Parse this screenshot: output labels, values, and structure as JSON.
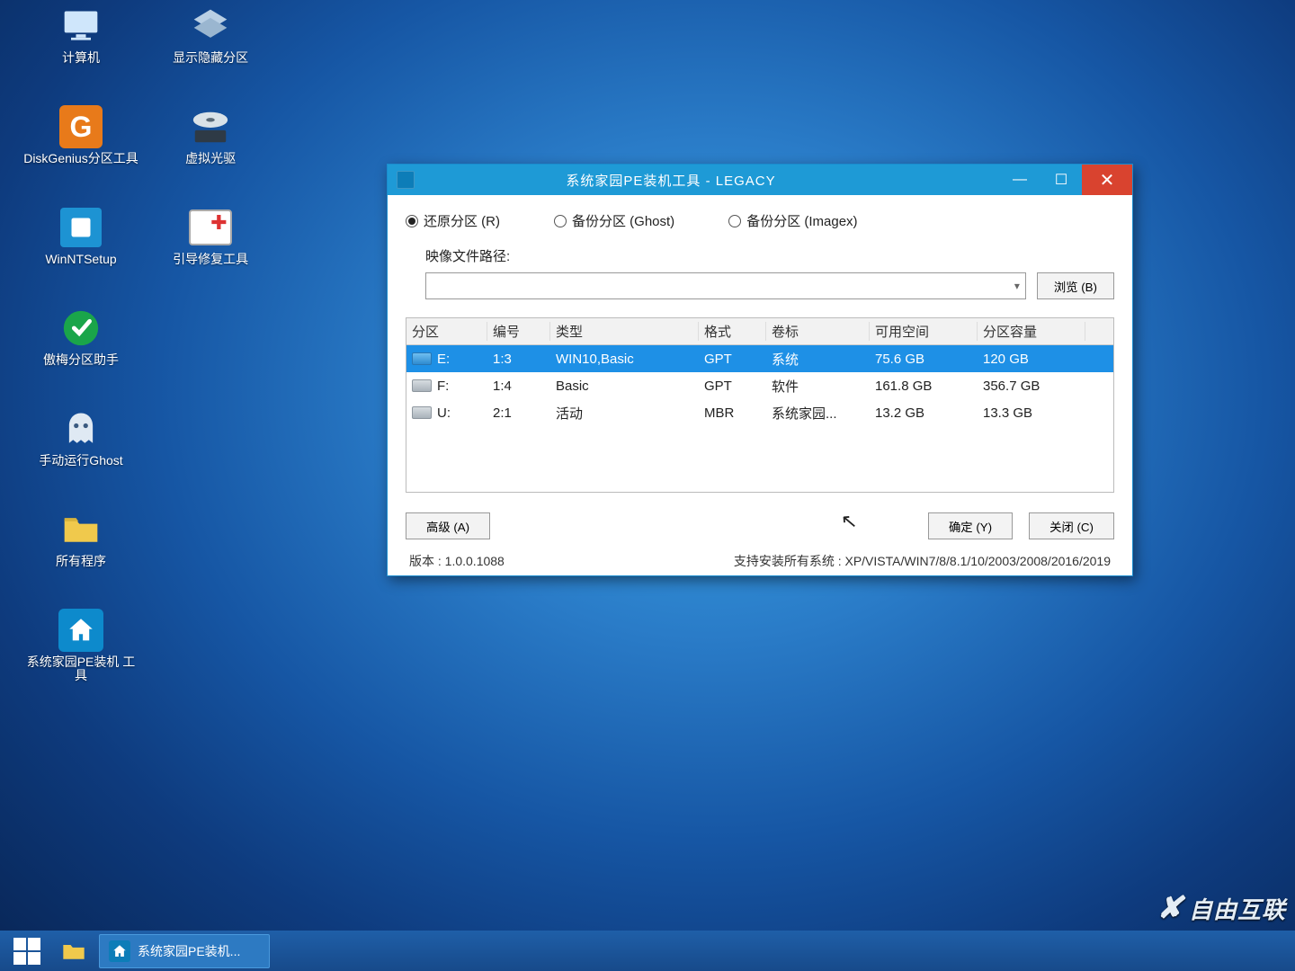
{
  "desktop_icons": [
    {
      "id": "computer",
      "label": "计算机"
    },
    {
      "id": "show_hidden",
      "label": "显示隐藏分区"
    },
    {
      "id": "diskgenius",
      "label": "DiskGenius分区工具"
    },
    {
      "id": "vcd",
      "label": "虚拟光驱"
    },
    {
      "id": "winnt",
      "label": "WinNTSetup"
    },
    {
      "id": "bootfix",
      "label": "引导修复工具"
    },
    {
      "id": "aomei",
      "label": "傲梅分区助手"
    },
    {
      "id": "ghost",
      "label": "手动运行Ghost"
    },
    {
      "id": "allprog",
      "label": "所有程序"
    },
    {
      "id": "petool",
      "label": "系统家园PE装机 工具"
    }
  ],
  "taskbar": {
    "task_label": "系统家园PE装机..."
  },
  "watermark": "自由互联",
  "window": {
    "title": "系统家园PE装机工具 - LEGACY",
    "radios": {
      "restore": "还原分区 (R)",
      "backup_ghost": "备份分区 (Ghost)",
      "backup_imagex": "备份分区 (Imagex)"
    },
    "image_path_label": "映像文件路径:",
    "browse_label": "浏览 (B)",
    "combo_value": "",
    "table": {
      "headers": {
        "partition": "分区",
        "number": "编号",
        "type": "类型",
        "format": "格式",
        "volume": "卷标",
        "free": "可用空间",
        "size": "分区容量"
      },
      "rows": [
        {
          "drive": "E:",
          "num": "1:3",
          "type": "WIN10,Basic",
          "fmt": "GPT",
          "vol": "系统",
          "free": "75.6 GB",
          "size": "120 GB",
          "sel": true,
          "icon": "hdd"
        },
        {
          "drive": "F:",
          "num": "1:4",
          "type": "Basic",
          "fmt": "GPT",
          "vol": "软件",
          "free": "161.8 GB",
          "size": "356.7 GB",
          "sel": false,
          "icon": "gray"
        },
        {
          "drive": "U:",
          "num": "2:1",
          "type": "活动",
          "fmt": "MBR",
          "vol": "系统家园...",
          "free": "13.2 GB",
          "size": "13.3 GB",
          "sel": false,
          "icon": "usb"
        }
      ]
    },
    "buttons": {
      "advanced": "高级 (A)",
      "ok": "确定 (Y)",
      "close": "关闭 (C)"
    },
    "status": {
      "version": "版本 : 1.0.0.1088",
      "support": "支持安装所有系统 : XP/VISTA/WIN7/8/8.1/10/2003/2008/2016/2019"
    }
  }
}
